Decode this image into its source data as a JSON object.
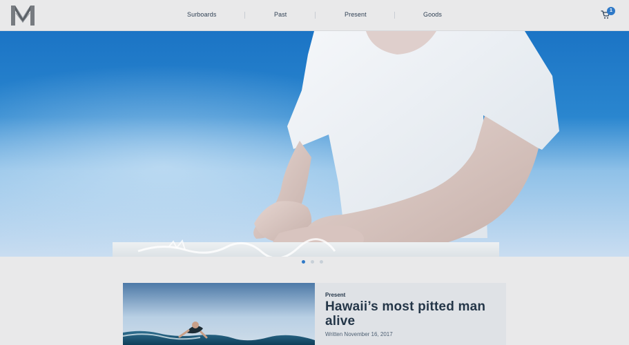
{
  "brand": {
    "logo_icon": "m-logo-icon"
  },
  "navigation": {
    "items": [
      {
        "label": "Surboards"
      },
      {
        "label": "Past"
      },
      {
        "label": "Present"
      },
      {
        "label": "Goods"
      }
    ]
  },
  "cart": {
    "icon": "cart-icon",
    "count": "1",
    "badge_color": "#2f79c7"
  },
  "hero": {
    "slide_count": 3,
    "active_slide": 1
  },
  "featured_article": {
    "category": "Present",
    "title": "Hawaii’s most pitted man alive",
    "date": "Written November 16, 2017"
  },
  "colors": {
    "background": "#e9e9ea",
    "accent": "#2f79c7",
    "heading": "#243648",
    "nav_text": "#2d3e52"
  }
}
